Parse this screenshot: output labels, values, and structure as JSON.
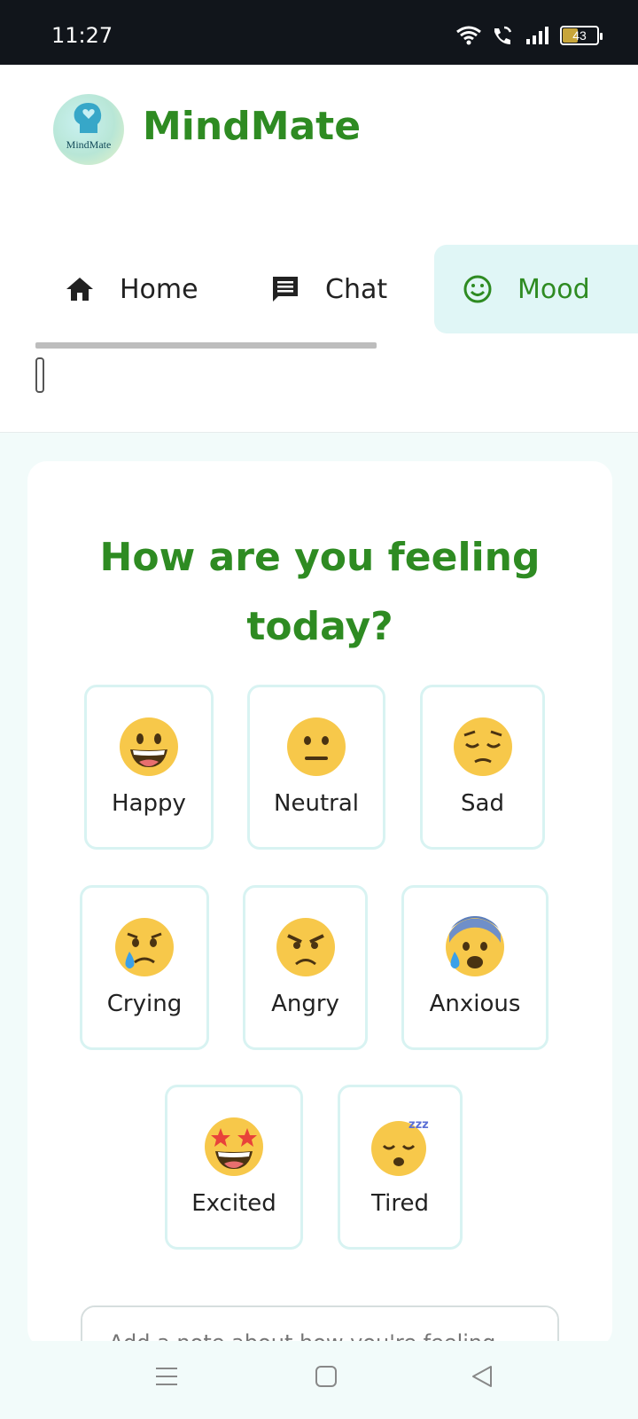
{
  "status_bar": {
    "time": "11:27",
    "battery_level": "43",
    "icons": [
      "wifi-icon",
      "wifi-call-icon",
      "signal-icon",
      "battery-icon"
    ]
  },
  "header": {
    "logo_text": "MindMate",
    "app_title": "MindMate"
  },
  "tabs": [
    {
      "label": "Home",
      "icon": "home-icon"
    },
    {
      "label": "Chat",
      "icon": "chat-icon"
    },
    {
      "label": "Mood",
      "icon": "smile-icon",
      "active": true
    }
  ],
  "mood_section": {
    "question": "How are you feeling today?",
    "moods": [
      {
        "label": "Happy",
        "icon": "grinning-face-icon"
      },
      {
        "label": "Neutral",
        "icon": "neutral-face-icon"
      },
      {
        "label": "Sad",
        "icon": "pensive-face-icon"
      },
      {
        "label": "Crying",
        "icon": "crying-face-icon"
      },
      {
        "label": "Angry",
        "icon": "angry-face-icon"
      },
      {
        "label": "Anxious",
        "icon": "anxious-face-icon"
      },
      {
        "label": "Excited",
        "icon": "star-struck-face-icon"
      },
      {
        "label": "Tired",
        "icon": "sleeping-face-icon"
      }
    ],
    "note_placeholder": "Add a note about how you're feeling..."
  },
  "colors": {
    "brand_green": "#2e8b22",
    "active_tab_bg": "#e0f6f6",
    "page_bg": "#f2fbfa",
    "mood_border": "#d8f3f2"
  }
}
